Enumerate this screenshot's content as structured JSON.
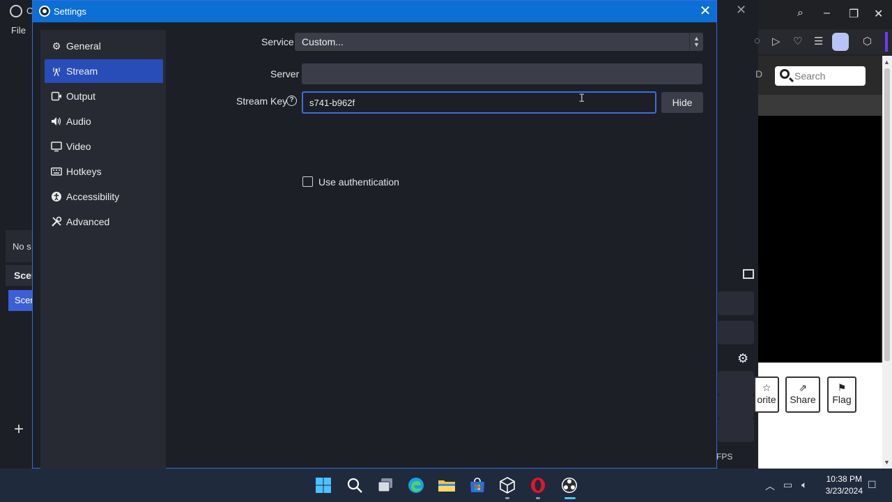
{
  "background_obs": {
    "title_fragment": "O",
    "menu_file": "File",
    "no_source_text": "No s",
    "scenes_header": "Scen",
    "scene_item": "Scen",
    "add_symbol": "+",
    "fps_text": "FPS"
  },
  "browser": {
    "search_placeholder": "Search",
    "header_fragment": "D",
    "actions": [
      {
        "label": "orite",
        "icon": "star-icon"
      },
      {
        "label": "Share",
        "icon": "share-icon"
      },
      {
        "label": "Flag",
        "icon": "flag-icon"
      }
    ],
    "colors": {
      "accent": "#6a3cff"
    }
  },
  "settings": {
    "title": "Settings",
    "nav": [
      {
        "label": "General",
        "icon": "gear-icon"
      },
      {
        "label": "Stream",
        "icon": "antenna-icon",
        "active": true
      },
      {
        "label": "Output",
        "icon": "output-icon"
      },
      {
        "label": "Audio",
        "icon": "speaker-icon"
      },
      {
        "label": "Video",
        "icon": "monitor-icon"
      },
      {
        "label": "Hotkeys",
        "icon": "keyboard-icon"
      },
      {
        "label": "Accessibility",
        "icon": "accessibility-icon"
      },
      {
        "label": "Advanced",
        "icon": "tools-icon"
      }
    ],
    "service_label": "Service",
    "service_value": "Custom...",
    "server_label": "Server",
    "server_value": "",
    "stream_key_label": "Stream Key",
    "stream_key_value": "s741-b962f",
    "hide_button": "Hide",
    "use_auth_label": "Use authentication",
    "use_auth_checked": false,
    "colors": {
      "titlebar": "#0c6fd6",
      "active_nav": "#284cb8",
      "focus": "#3d6ee0"
    }
  },
  "taskbar": {
    "time": "10:38 PM",
    "date": "3/23/2024"
  }
}
